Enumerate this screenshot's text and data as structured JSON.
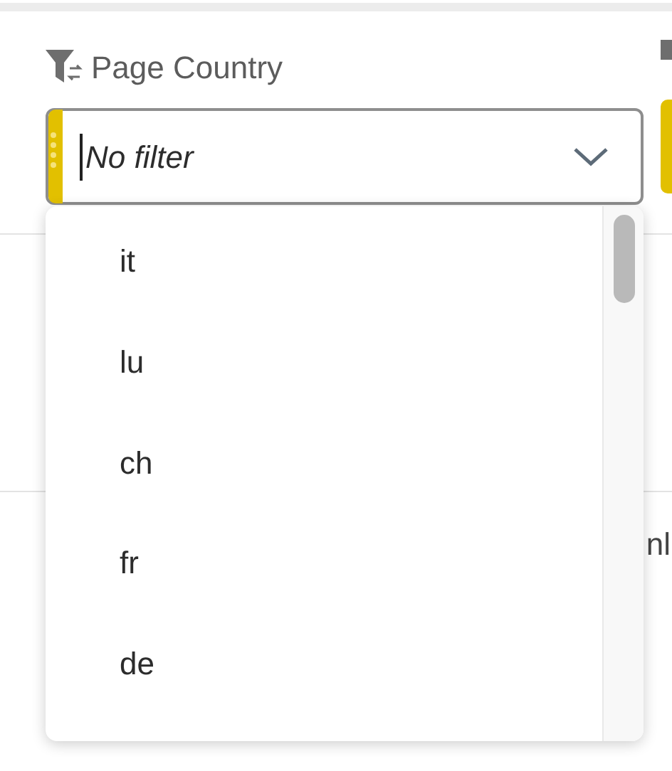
{
  "filter": {
    "label": "Page Country",
    "placeholder": "No filter",
    "expanded": true
  },
  "options": [
    {
      "label": "it"
    },
    {
      "label": "lu"
    },
    {
      "label": "ch"
    },
    {
      "label": "fr"
    },
    {
      "label": "de"
    }
  ],
  "background_table": {
    "cell_text": "nl"
  }
}
